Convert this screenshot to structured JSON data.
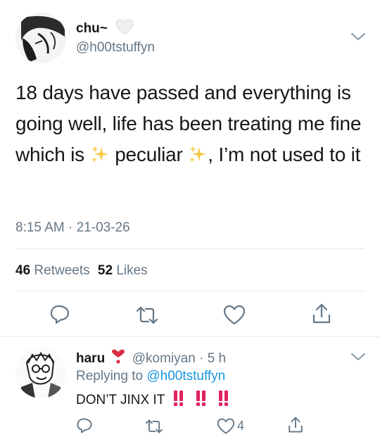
{
  "main_tweet": {
    "display_name": "chu~",
    "handle": "@h00tstuffyn",
    "text_part1": "18 days have passed and everything is going well, life has been treating me fine which is",
    "text_word": "peculiar",
    "text_part2": ", I’m not used to it",
    "time": "8:15 AM",
    "date": "21-03-26",
    "retweets_count": "46",
    "retweets_label": "Retweets",
    "likes_count": "52",
    "likes_label": "Likes"
  },
  "reply": {
    "display_name": "haru",
    "handle": "@komiyan",
    "time": "5 h",
    "replying_label": "Replying to",
    "replying_to": "@h00tstuffyn",
    "text": "DON’T JINX IT",
    "like_count": "4"
  },
  "icons": {
    "heart_emoji": "white-heart-icon",
    "red_heart_emoji": "red-heart-icon",
    "sparkles": "sparkles-icon",
    "double_exclamation": "double-exclamation-icon"
  },
  "colors": {
    "accent": "#1b95e0",
    "muted": "#657786",
    "text": "#14171a",
    "divider": "#e6ecf0"
  }
}
